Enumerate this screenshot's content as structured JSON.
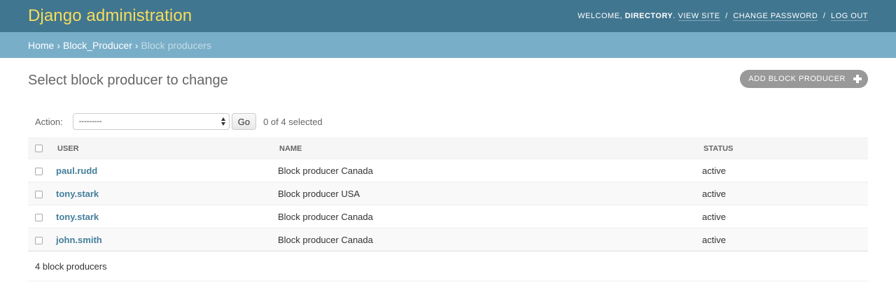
{
  "header": {
    "branding": "Django administration",
    "welcome_label": "Welcome,",
    "username": "Directory",
    "view_site": "View site",
    "change_password": "Change password",
    "log_out": "Log out",
    "separator": "/"
  },
  "breadcrumbs": {
    "home": "Home",
    "app": "Block_Producer",
    "current": "Block producers",
    "separator": "›"
  },
  "page": {
    "title": "Select block producer to change",
    "add_button": "Add block producer"
  },
  "actions": {
    "label": "Action:",
    "selected_option": "---------",
    "go_label": "Go",
    "counter": "0 of 4 selected"
  },
  "table": {
    "columns": [
      "User",
      "Name",
      "Status"
    ],
    "rows": [
      {
        "user": "paul.rudd",
        "name": "Block producer Canada",
        "status": "active"
      },
      {
        "user": "tony.stark",
        "name": "Block producer USA",
        "status": "active"
      },
      {
        "user": "tony.stark",
        "name": "Block producer Canada",
        "status": "active"
      },
      {
        "user": "john.smith",
        "name": "Block producer Canada",
        "status": "active"
      }
    ]
  },
  "paginator": {
    "text": "4 block producers"
  },
  "colors": {
    "header_bg": "#417690",
    "branding": "#f5dd5d",
    "breadcrumbs_bg": "#79aec8",
    "link": "#447e9b",
    "add_button_bg": "#999999"
  }
}
